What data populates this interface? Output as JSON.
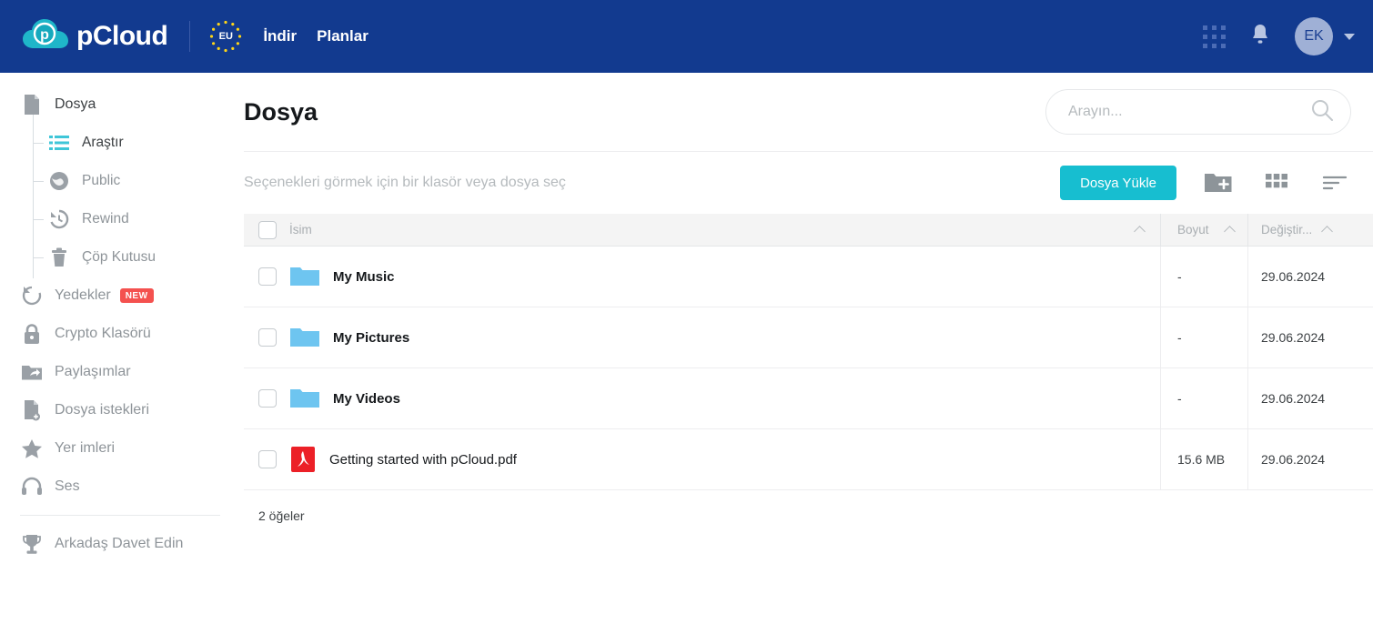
{
  "header": {
    "brand_name": "pCloud",
    "logo_icon": "pcloud-cloud-logo",
    "eu_badge_text": "EU",
    "nav": [
      {
        "label": "İndir",
        "name": "nav-indir"
      },
      {
        "label": "Planlar",
        "name": "nav-planlar"
      }
    ],
    "apps_icon": "grid-apps-icon",
    "notifications_icon": "bell-icon",
    "avatar_initials": "EK",
    "caret_icon": "chevron-down-icon",
    "bg_color": "#123a8f"
  },
  "sidebar": {
    "items": [
      {
        "label": "Dosya",
        "icon": "file-icon",
        "active": true
      },
      {
        "label": "Araştır",
        "icon": "list-icon",
        "sub": true,
        "selected": true
      },
      {
        "label": "Public",
        "icon": "globe-icon",
        "sub": true
      },
      {
        "label": "Rewind",
        "icon": "rewind-clock-icon",
        "sub": true
      },
      {
        "label": "Çöp Kutusu",
        "icon": "trash-icon",
        "sub": true
      },
      {
        "label": "Yedekler",
        "icon": "backup-refresh-icon",
        "badge": "NEW"
      },
      {
        "label": "Crypto Klasörü",
        "icon": "lock-icon"
      },
      {
        "label": "Paylaşımlar",
        "icon": "shared-folder-icon"
      },
      {
        "label": "Dosya istekleri",
        "icon": "file-request-icon"
      },
      {
        "label": "Yer imleri",
        "icon": "star-icon"
      },
      {
        "label": "Ses",
        "icon": "headphones-icon"
      },
      {
        "label": "Arkadaş Davet Edin",
        "icon": "trophy-icon"
      }
    ],
    "badge_color": "#f4514f"
  },
  "main": {
    "page_title": "Dosya",
    "search": {
      "placeholder": "Arayın...",
      "value": "",
      "icon": "search-icon"
    },
    "hint_text": "Seçenekleri görmek için bir klasör veya dosya seç",
    "upload_button": "Dosya Yükle",
    "upload_button_color": "#17bed0",
    "toolbar_icons": [
      {
        "name": "new-folder-icon",
        "label": "new-folder"
      },
      {
        "name": "grid-view-icon",
        "label": "grid-view"
      },
      {
        "name": "sort-icon",
        "label": "sort"
      }
    ],
    "table": {
      "columns": [
        {
          "label": "İsim",
          "sort": "asc"
        },
        {
          "label": "Boyut",
          "sort": "asc"
        },
        {
          "label": "Değiştir...",
          "sort": "asc"
        }
      ],
      "rows": [
        {
          "name": "My Music",
          "type": "folder",
          "size": "-",
          "modified": "29.06.2024"
        },
        {
          "name": "My Pictures",
          "type": "folder",
          "size": "-",
          "modified": "29.06.2024"
        },
        {
          "name": "My Videos",
          "type": "folder",
          "size": "-",
          "modified": "29.06.2024"
        },
        {
          "name": "Getting started with pCloud.pdf",
          "type": "pdf",
          "size": "15.6 MB",
          "modified": "29.06.2024"
        }
      ],
      "item_count": "2 öğeler"
    }
  }
}
